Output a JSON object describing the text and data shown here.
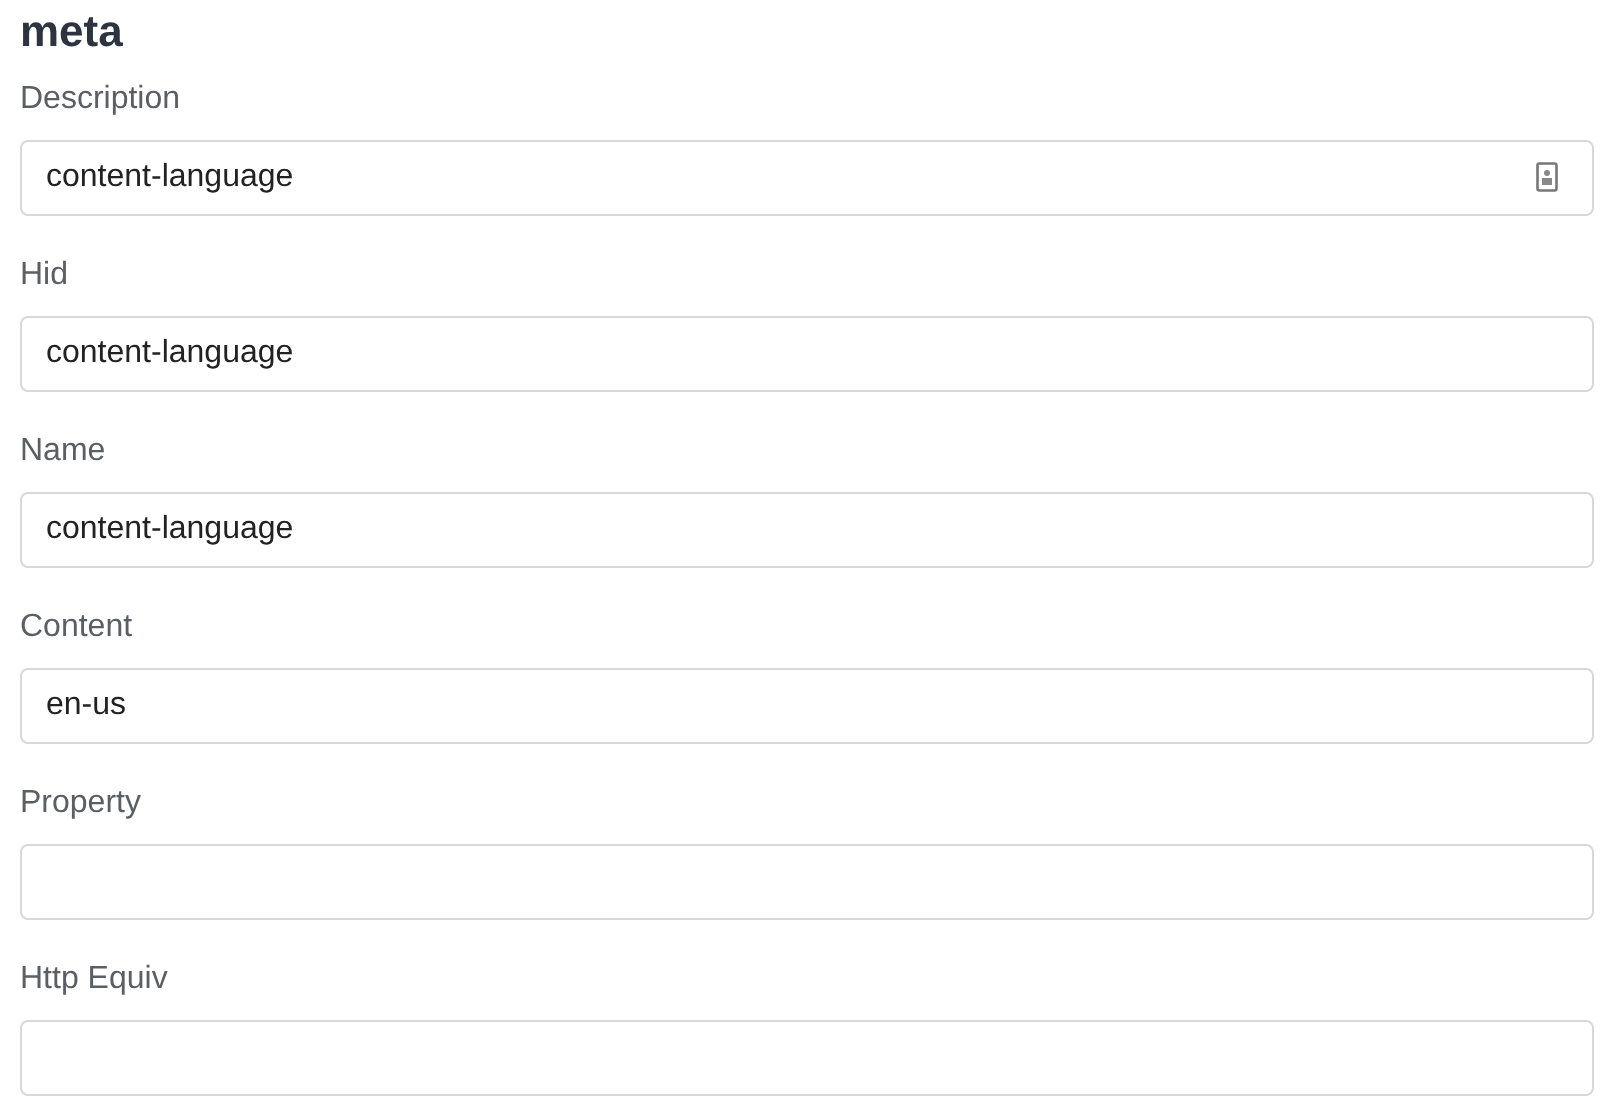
{
  "title": "meta",
  "fields": [
    {
      "label": "Description",
      "value": "content-language",
      "autofill_icon": true
    },
    {
      "label": "Hid",
      "value": "content-language",
      "autofill_icon": false
    },
    {
      "label": "Name",
      "value": "content-language",
      "autofill_icon": false
    },
    {
      "label": "Content",
      "value": "en-us",
      "autofill_icon": false
    },
    {
      "label": "Property",
      "autofill_icon": false
    },
    {
      "label": "Http Equiv",
      "autofill_icon": false
    }
  ]
}
